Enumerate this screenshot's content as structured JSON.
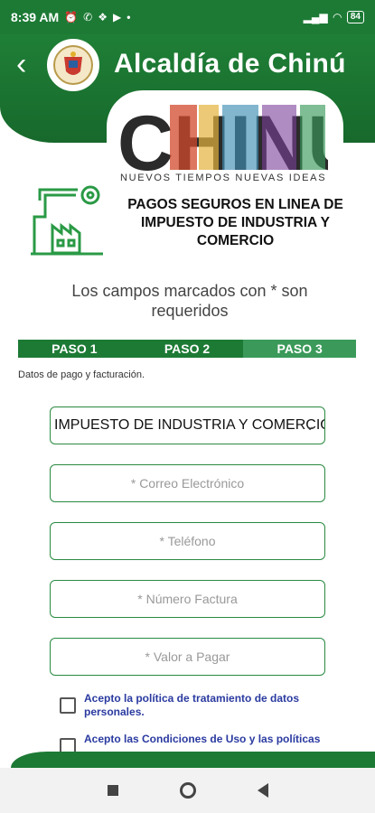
{
  "status_bar": {
    "time": "8:39 AM",
    "battery": "84"
  },
  "header": {
    "title": "Alcaldía de Chinú",
    "back_icon": "chevron-left-icon"
  },
  "logo": {
    "word": "CHINÚ",
    "slogan": "NUEVOS TIEMPOS NUEVAS IDEAS"
  },
  "page": {
    "heading": "PAGOS SEGUROS EN LINEA DE IMPUESTO DE INDUSTRIA Y COMERCIO",
    "required_note": "Los campos marcados con * son requeridos",
    "section_label": "Datos de pago y facturación."
  },
  "steps": [
    "PASO 1",
    "PASO 2",
    "PASO 3"
  ],
  "form": {
    "tax_select_value": "IMPUESTO DE INDUSTRIA Y COMERCIO",
    "email_placeholder": "* Correo Electrónico",
    "phone_placeholder": "* Teléfono",
    "invoice_placeholder": "* Número Factura",
    "amount_placeholder": "* Valor a Pagar"
  },
  "checkboxes": {
    "privacy": "Acepto la política de tratamiento de datos personales.",
    "terms": "Acepto las Condiciones de Uso y las políticas"
  },
  "colors": {
    "brand_green": "#1d7a35",
    "link_blue": "#2a3aa0"
  }
}
